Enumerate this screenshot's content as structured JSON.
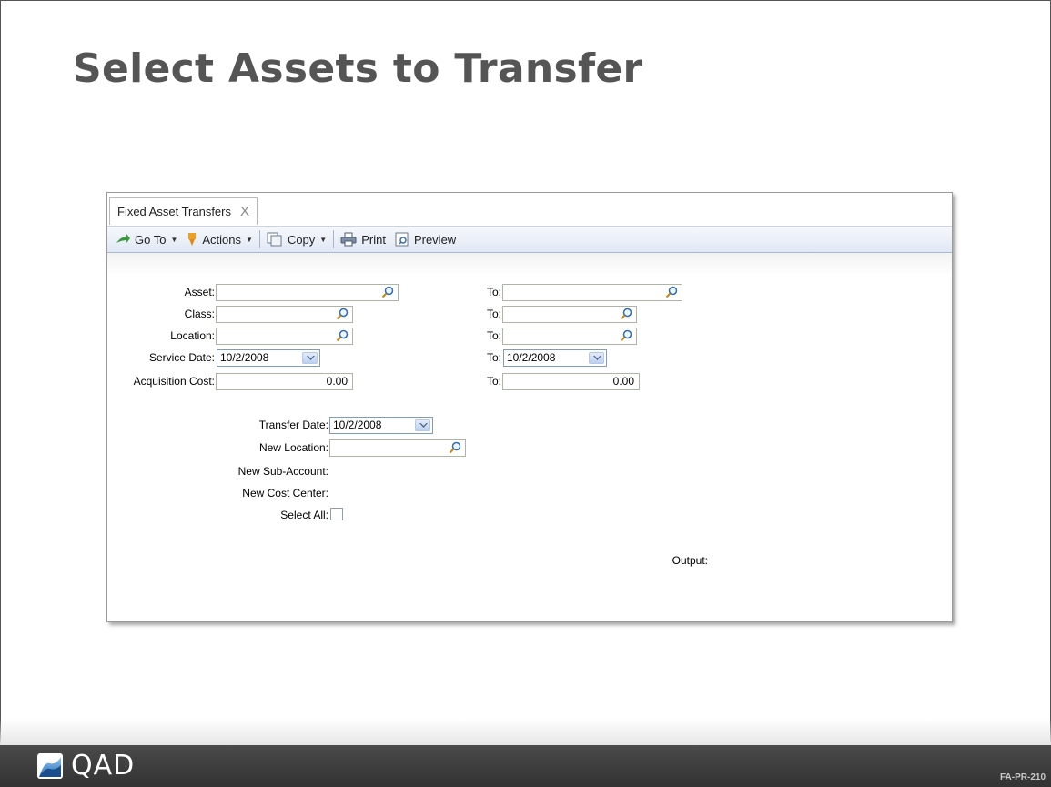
{
  "slide": {
    "title": "Select Assets to Transfer",
    "code": "FA-PR-210",
    "logo_text": "QAD"
  },
  "window": {
    "tab_label": "Fixed Asset Transfers",
    "tab_close": "X"
  },
  "toolbar": {
    "goto_label": "Go To",
    "actions_label": "Actions",
    "copy_label": "Copy",
    "print_label": "Print",
    "preview_label": "Preview",
    "icons": [
      "goto-arrow-icon",
      "actions-pin-icon",
      "copy-icon",
      "print-icon",
      "preview-icon"
    ]
  },
  "form": {
    "asset_label": "Asset:",
    "asset_value": "",
    "asset_to_label": "To:",
    "asset_to_value": "",
    "class_label": "Class:",
    "class_value": "",
    "class_to_label": "To:",
    "class_to_value": "",
    "location_label": "Location:",
    "location_value": "",
    "location_to_label": "To:",
    "location_to_value": "",
    "service_date_label": "Service Date:",
    "service_date_value": "10/2/2008",
    "service_date_to_label": "To:",
    "service_date_to_value": "10/2/2008",
    "acq_cost_label": "Acquisition Cost:",
    "acq_cost_value": "0.00",
    "acq_cost_to_label": "To:",
    "acq_cost_to_value": "0.00",
    "transfer_date_label": "Transfer Date:",
    "transfer_date_value": "10/2/2008",
    "new_location_label": "New Location:",
    "new_location_value": "",
    "new_subaccount_label": "New Sub-Account:",
    "new_cost_center_label": "New Cost Center:",
    "select_all_label": "Select All:",
    "select_all_checked": false,
    "output_label": "Output:"
  },
  "colors": {
    "title": "#555555",
    "footer": "#3c3c3c",
    "toolbar": "#e1e8f4"
  }
}
